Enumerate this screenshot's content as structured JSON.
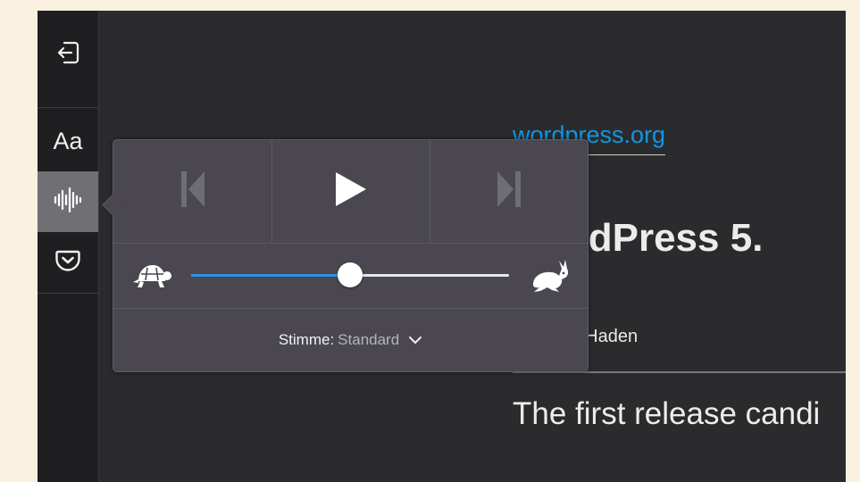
{
  "toolbar": {
    "close_icon": "exit-icon",
    "type_label": "Aa",
    "narrate_icon": "audio-waveform-icon",
    "pocket_icon": "pocket-icon"
  },
  "article": {
    "domain": "wordpress.org",
    "headline": "WordPress 5.",
    "byline": "Josepha Haden",
    "paragraph": "The first release candi"
  },
  "narrate": {
    "back_icon": "skip-back-icon",
    "play_icon": "play-icon",
    "forward_icon": "skip-forward-icon",
    "slow_icon": "tortoise-icon",
    "fast_icon": "hare-icon",
    "speed_fraction": 0.5,
    "voice_label": "Stimme:",
    "voice_value": "Standard"
  },
  "colors": {
    "accent": "#2f90e6",
    "link": "#1196e2",
    "popup_bg": "#4a4750",
    "toolbar_active": "#707074"
  }
}
